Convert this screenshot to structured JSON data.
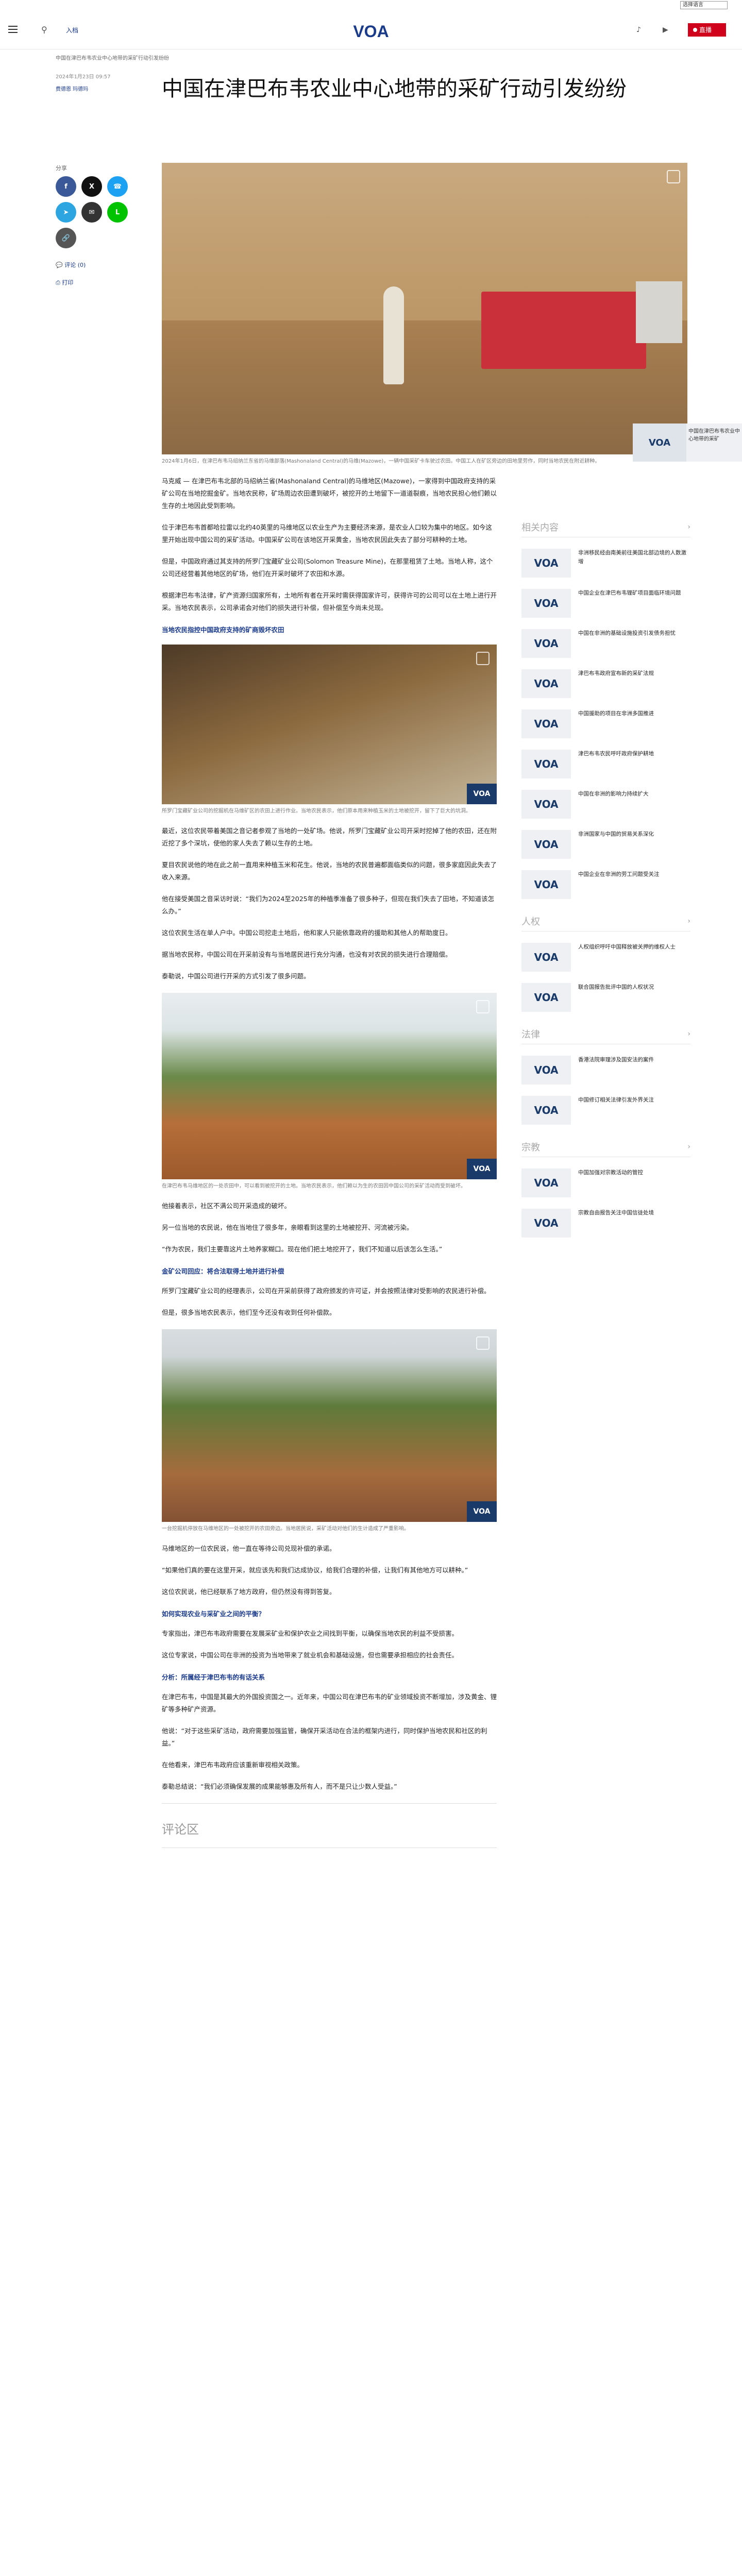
{
  "topbar": {
    "language_select": "选择语言"
  },
  "header": {
    "search_label": "入档",
    "logo": "VOA",
    "live_label": "直播"
  },
  "breadcrumb": "中国在津巴布韦农业中心地带的采矿行动引发纷纷",
  "article": {
    "title": "中国在津巴布韦农业中心地带的采矿行动引发纷纷",
    "date": "2024年1月23日 09:57",
    "author": "费德恩 玛德玛",
    "share_label": "分享",
    "comments_link": "评论 (0)",
    "print_link": "打印",
    "hero_caption": "2024年1月6日，在津巴布韦马绍纳兰东省的马维部落(Mashonaland Central)的马维(Mazowe)，一辆中国采矿卡车驶过农田。中国工人在矿区旁边的田地里劳作，同时当地农民在附近耕种。",
    "paragraphs": [
      "马克威 — 在津巴布韦北部的马绍纳兰省(Mashonaland Central)的马维地区(Mazowe)，一家得到中国政府支持的采矿公司在当地挖掘金矿。当地农民称，矿场周边农田遭到破坏，被挖开的土地留下一道道裂痕，当地农民担心他们赖以生存的土地因此受到影响。",
      "位于津巴布韦首都哈拉雷以北约40英里的马维地区以农业生产为主要经济来源，是农业人口较为集中的地区。如今这里开始出现中国公司的采矿活动。中国采矿公司在该地区开采黄金，当地农民因此失去了部分可耕种的土地。",
      "但是，中国政府通过其支持的所罗门宝藏矿业公司(Solomon Treasure Mine)，在那里租赁了土地。当地人称，这个公司还经营着其他地区的矿场，他们在开采时破坏了农田和水源。",
      "根据津巴布韦法律，矿产资源归国家所有，土地所有者在开采时需获得国家许可，获得许可的公司可以在土地上进行开采。当地农民表示，公司承诺会对他们的损失进行补偿，但补偿至今尚未兑现。"
    ],
    "subhead1": "当地农民指控中国政府支持的矿商毁坏农田",
    "fig1_caption": "所罗门宝藏矿业公司的挖掘机在马维矿区的农田上进行作业。当地农民表示，他们原本用来种植玉米的土地被挖开，留下了巨大的坑洞。",
    "paragraphs2": [
      "最近，这位农民带着美国之音记者参观了当地的一处矿场。他说，所罗门宝藏矿业公司开采时挖掉了他的农田，还在附近挖了多个深坑，使他的家人失去了赖以生存的土地。",
      "夏目农民说他的地在此之前一直用来种植玉米和花生。他说，当地的农民普遍都面临类似的问题，很多家庭因此失去了收入来源。",
      "他在接受美国之音采访时说：“我们为2024至2025年的种植季准备了很多种子，但现在我们失去了田地，不知道该怎么办。”",
      "这位农民生活在单人户中。中国公司挖走土地后，他和家人只能依靠政府的援助和其他人的帮助度日。",
      "据当地农民称，中国公司在开采前没有与当地居民进行充分沟通，也没有对农民的损失进行合理赔偿。",
      "泰勒说，中国公司进行开采的方式引发了很多问题。"
    ],
    "fig2_caption": "在津巴布韦马维地区的一处农田中，可以看到被挖开的土地。当地农民表示，他们赖以为生的农田因中国公司的采矿活动而受到破坏。",
    "paragraphs3": [
      "他接着表示，社区不满公司开采造成的破坏。",
      "另一位当地的农民说，他在当地住了很多年，亲眼看到这里的土地被挖开、河流被污染。",
      "“作为农民，我们主要靠这片土地养家糊口。现在他们把土地挖开了，我们不知道以后该怎么生活。”"
    ],
    "subhead2": "金矿公司回应：将合法取得土地并进行补偿",
    "paragraphs4": [
      "所罗门宝藏矿业公司的经理表示，公司在开采前获得了政府颁发的许可证，并会按照法律对受影响的农民进行补偿。",
      "但是，很多当地农民表示，他们至今还没有收到任何补偿款。"
    ],
    "fig3_caption": "一台挖掘机停放在马维地区的一处被挖开的农田旁边。当地居民说，采矿活动对他们的生计造成了严重影响。",
    "paragraphs5": [
      "马维地区的一位农民说，他一直在等待公司兑现补偿的承诺。",
      "“如果他们真的要在这里开采，就应该先和我们达成协议，给我们合理的补偿，让我们有其他地方可以耕种。”",
      "这位农民说，他已经联系了地方政府，但仍然没有得到答复。"
    ],
    "subhead3": "如何实现农业与采矿业之间的平衡？",
    "paragraphs6": [
      "专家指出，津巴布韦政府需要在发展采矿业和保护农业之间找到平衡，以确保当地农民的利益不受损害。",
      "这位专家说，中国公司在非洲的投资为当地带来了就业机会和基础设施，但也需要承担相应的社会责任。"
    ],
    "subhead4": "分析：所属经于津巴布韦的有话关系",
    "paragraphs7": [
      "在津巴布韦，中国是其最大的外国投资国之一。近年来，中国公司在津巴布韦的矿业领域投资不断增加，涉及黄金、锂矿等多种矿产资源。",
      "他说：“对于这些采矿活动，政府需要加强监管，确保开采活动在合法的框架内进行，同时保护当地农民和社区的利益。”",
      "在他看来，津巴布韦政府应该重新审视相关政策。",
      "泰勒总结说：“我们必须确保发展的成果能够惠及所有人，而不是只让少数人受益。”"
    ],
    "comments_heading": "评论区"
  },
  "sidebar": {
    "sections": [
      {
        "title": "相关内容",
        "items": [
          "非洲移民经由南美前往美国北部边境的人数激增",
          "中国企业在津巴布韦锂矿项目面临环境问题",
          "中国在非洲的基础设施投资引发债务担忧",
          "津巴布韦政府宣布新的采矿法规",
          "中国援助的项目在非洲多国推进",
          "津巴布韦农民呼吁政府保护耕地",
          "中国在非洲的影响力持续扩大",
          "非洲国家与中国的贸易关系深化",
          "中国企业在非洲的劳工问题受关注"
        ]
      },
      {
        "title": "人权",
        "items": [
          "人权组织呼吁中国释放被关押的维权人士",
          "联合国报告批评中国的人权状况"
        ]
      },
      {
        "title": "法律",
        "items": [
          "香港法院审理涉及国安法的案件",
          "中国修订相关法律引发外界关注"
        ]
      },
      {
        "title": "宗教",
        "items": [
          "中国加强对宗教活动的管控",
          "宗教自由报告关注中国信徒处境"
        ]
      }
    ]
  },
  "floating_video": {
    "logo": "VOA",
    "text": "中国在津巴布韦农业中心地带的采矿"
  }
}
